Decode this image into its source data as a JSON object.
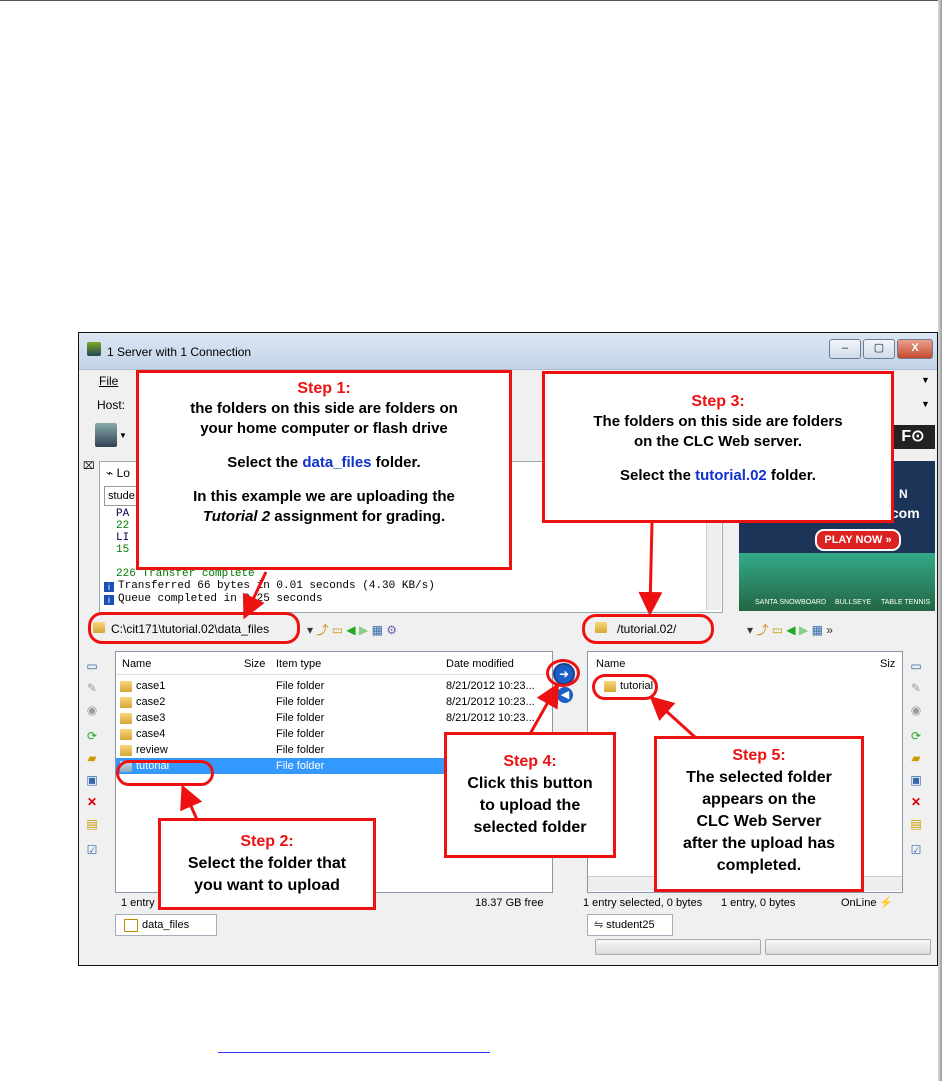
{
  "window": {
    "title": "1 Server with 1 Connection",
    "minimize": "–",
    "maximize": "▢",
    "close": "X"
  },
  "menu": {
    "file": "File"
  },
  "host": {
    "label": "Host:"
  },
  "log": {
    "tab": "Lo",
    "input_value": "stude",
    "lines": [
      "PA",
      "22",
      "LI",
      "15",
      "226 Transfer complete",
      "Transferred 66 bytes in 0.01 seconds (4.30 KB/s)",
      "Queue completed in 0.25 seconds"
    ]
  },
  "ad": {
    "line1": "N",
    "line2": ".com",
    "play": "PLAY NOW »",
    "games": [
      "SANTA SNOWBOARD",
      "BULLSEYE",
      "TABLE TENNIS"
    ]
  },
  "local": {
    "path": "C:\\cit171\\tutorial.02\\data_files",
    "columns": {
      "name": "Name",
      "size": "Size",
      "type": "Item type",
      "date": "Date modified"
    },
    "rows": [
      {
        "name": "case1",
        "type": "File folder",
        "date": "8/21/2012 10:23..."
      },
      {
        "name": "case2",
        "type": "File folder",
        "date": "8/21/2012 10:23..."
      },
      {
        "name": "case3",
        "type": "File folder",
        "date": "8/21/2012 10:23..."
      },
      {
        "name": "case4",
        "type": "File folder",
        "date": ""
      },
      {
        "name": "review",
        "type": "File folder",
        "date": ""
      },
      {
        "name": "tutorial",
        "type": "File folder",
        "date": ""
      }
    ],
    "status_left": "1 entry s",
    "status_right": "18.37 GB free",
    "tab": "data_files"
  },
  "remote": {
    "path": "/tutorial.02/",
    "columns": {
      "name": "Name",
      "size": "Siz"
    },
    "rows": [
      {
        "name": "tutorial"
      }
    ],
    "status_sel": "1 entry selected, 0 bytes",
    "status_entry": "1 entry, 0 bytes",
    "status_online": "OnLine",
    "tab": "student25"
  },
  "callouts": {
    "step1": {
      "title": "Step 1:",
      "line1": "the folders on this side are folders on",
      "line2": "your home computer or flash drive",
      "select_pre": "Select the ",
      "select_name": "data_files",
      "select_post": " folder.",
      "ex1": "In this example we are uploading the",
      "ex2_italic": "Tutorial 2",
      "ex2_rest": " assignment for grading."
    },
    "step2": {
      "title": "Step 2:",
      "line1": "Select the folder that",
      "line2": "you want to upload"
    },
    "step3": {
      "title": "Step 3:",
      "line1": "The folders on this side are folders",
      "line2": "on the CLC Web server.",
      "select_pre": "Select the ",
      "select_name": "tutorial.02",
      "select_post": " folder."
    },
    "step4": {
      "title": "Step 4:",
      "line1": "Click this button",
      "line2": "to upload the",
      "line3": "selected folder"
    },
    "step5": {
      "title": "Step 5:",
      "line1": "The selected folder",
      "line2": "appears on the",
      "line3": "CLC Web Server",
      "line4": "after the upload has",
      "line5": "completed."
    }
  },
  "colors": {
    "callout_border": "#ee1111",
    "highlight_blue": "#1133cc",
    "selection": "#3399ff"
  }
}
